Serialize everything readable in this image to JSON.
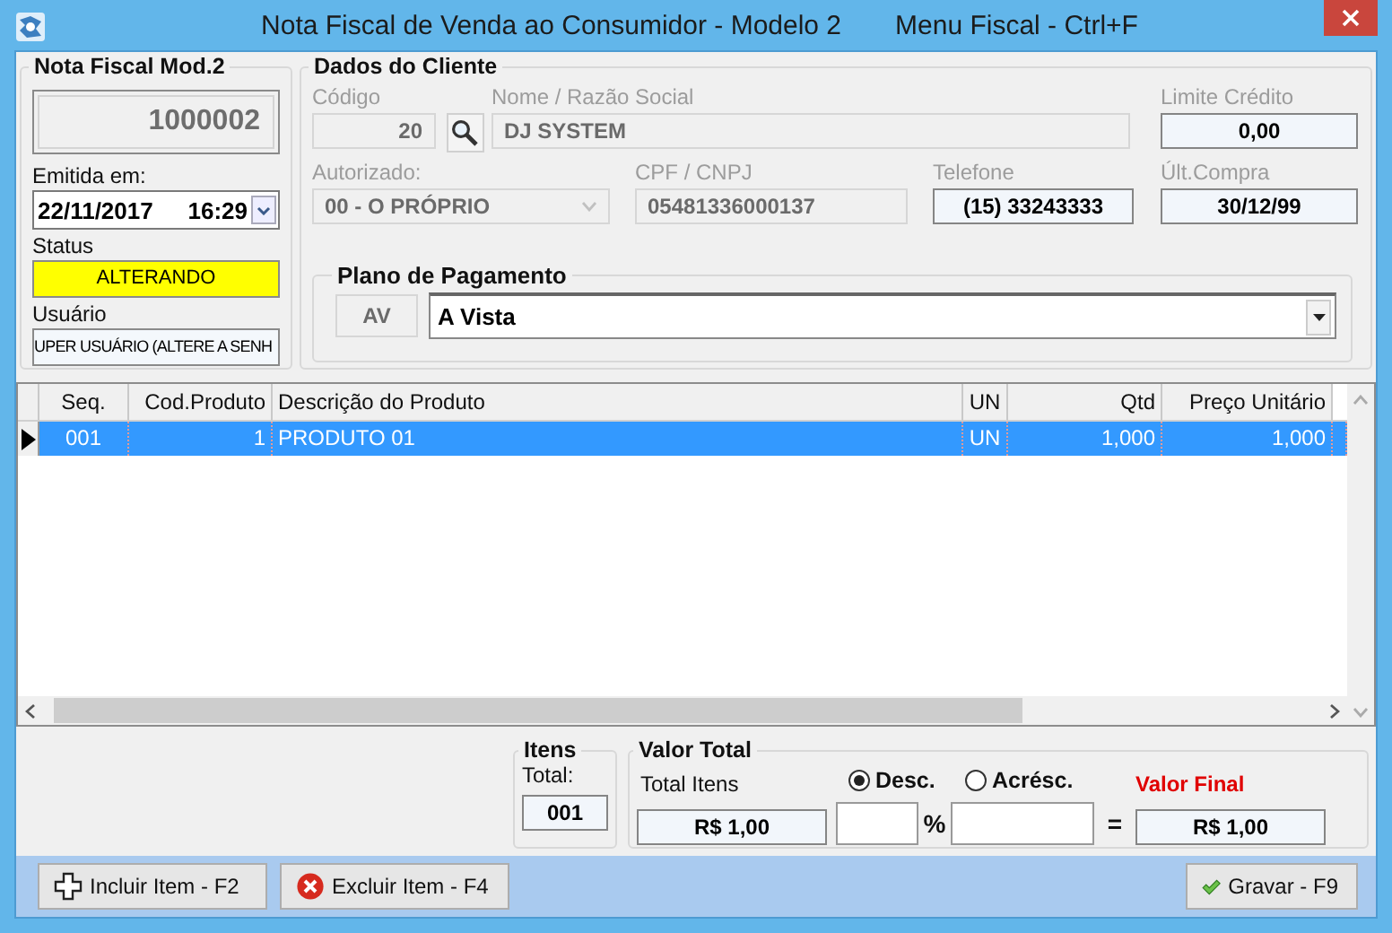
{
  "window": {
    "title": "Nota Fiscal de Venda ao Consumidor - Modelo 2",
    "menu_hint": "Menu Fiscal - Ctrl+F"
  },
  "nota": {
    "heading": "Nota Fiscal Mod.2",
    "number": "1000002",
    "issued_label": "Emitida em:",
    "date": "22/11/2017",
    "time": "16:29",
    "status_label": "Status",
    "status": "ALTERANDO",
    "user_label": "Usuário",
    "user": "UPER USUÁRIO (ALTERE A SENH"
  },
  "cliente": {
    "heading": "Dados do Cliente",
    "fields": [
      {
        "kind": "lookup",
        "label": "Código",
        "value": "20",
        "disabled": true
      },
      {
        "kind": "text",
        "label": "Nome / Razão Social",
        "value": "DJ SYSTEM",
        "disabled": true
      },
      {
        "kind": "text",
        "label": "Limite Crédito",
        "value": "0,00",
        "disabled": false
      },
      {
        "kind": "combo",
        "label": "Autorizado:",
        "value": "00 - O PRÓPRIO",
        "disabled": true
      },
      {
        "kind": "text",
        "label": "CPF / CNPJ",
        "value": "05481336000137",
        "disabled": true
      },
      {
        "kind": "text",
        "label": "Telefone",
        "value": "(15) 33243333",
        "disabled": false
      },
      {
        "kind": "text",
        "label": "Últ.Compra",
        "value": "30/12/99",
        "disabled": false
      }
    ]
  },
  "payment": {
    "heading": "Plano de Pagamento",
    "code": {
      "value": "AV",
      "disabled": true
    },
    "plan": "A Vista"
  },
  "table": {
    "columns": [
      "Seq.",
      "Cod.Produto",
      "Descrição do Produto",
      "UN",
      "Qtd",
      "Preço Unitário"
    ],
    "rows": [
      {
        "cells": [
          "001",
          "1",
          "PRODUTO 01",
          "UN",
          "1,000",
          "1,000"
        ],
        "selected": true
      }
    ]
  },
  "totals": {
    "items_heading": "Itens",
    "total_label": "Total:",
    "total": "001",
    "value_heading": "Valor Total",
    "items_label": "Total Itens",
    "items_value": "R$ 1,00",
    "adjust": [
      {
        "label": "Desc.",
        "selected": true
      },
      {
        "label": "Acrésc.",
        "selected": false
      }
    ],
    "percent": "%",
    "equals": "=",
    "final_label": "Valor Final",
    "final": "R$ 1,00"
  },
  "buttons": [
    {
      "label": "Incluir Item - F2",
      "kind": "add"
    },
    {
      "label": "Excluir Item - F4",
      "kind": "delete"
    },
    {
      "label": "Gravar - F9",
      "kind": "save"
    }
  ]
}
